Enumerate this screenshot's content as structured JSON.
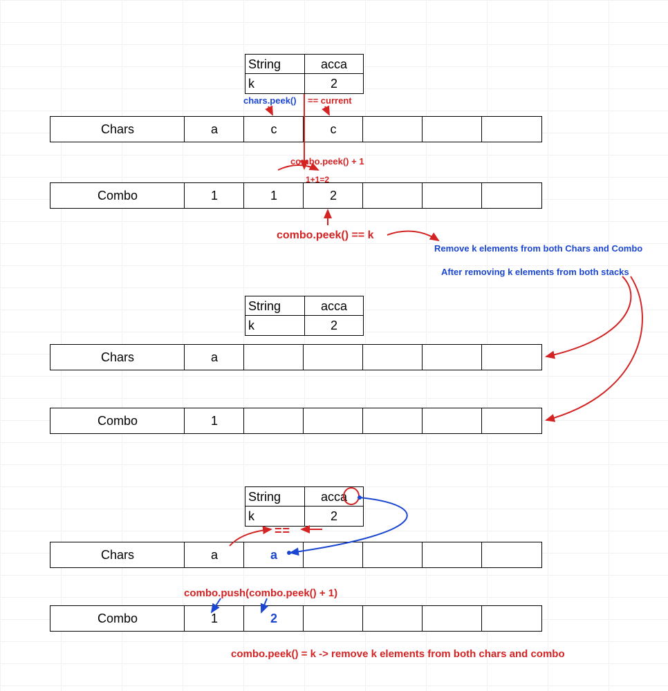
{
  "labels": {
    "string": "String",
    "k": "k",
    "chars": "Chars",
    "combo": "Combo"
  },
  "step1": {
    "string_val": "acca",
    "k_val": "2",
    "chars": [
      "a",
      "c",
      "c",
      "",
      "",
      "",
      ""
    ],
    "combo": [
      "1",
      "1",
      "2",
      "",
      "",
      "",
      ""
    ],
    "ann": {
      "chars_peek": "chars.peek()",
      "eq_current": "== current",
      "combo_peek_plus": "combo.peek() + 1",
      "sum": "1+1=2",
      "combo_eq_k": "combo.peek() == k",
      "remove_msg": "Remove k elements from both Chars and Combo",
      "after_msg": "After removing k elements from both stacks"
    }
  },
  "step2": {
    "string_val": "acca",
    "k_val": "2",
    "chars": [
      "a",
      "",
      "",
      "",
      "",
      "",
      ""
    ],
    "combo": [
      "1",
      "",
      "",
      "",
      "",
      "",
      ""
    ]
  },
  "step3": {
    "string_val": "acca",
    "k_val": "2",
    "chars": [
      "a",
      "a",
      "",
      "",
      "",
      "",
      ""
    ],
    "combo": [
      "1",
      "2",
      "",
      "",
      "",
      "",
      ""
    ],
    "ann": {
      "eq": "==",
      "push": "combo.push(combo.peek() + 1)",
      "final": "combo.peek() = k    -> remove k elements from both chars and combo"
    }
  },
  "colors": {
    "red": "#d32323",
    "blue": "#1b46d1"
  }
}
